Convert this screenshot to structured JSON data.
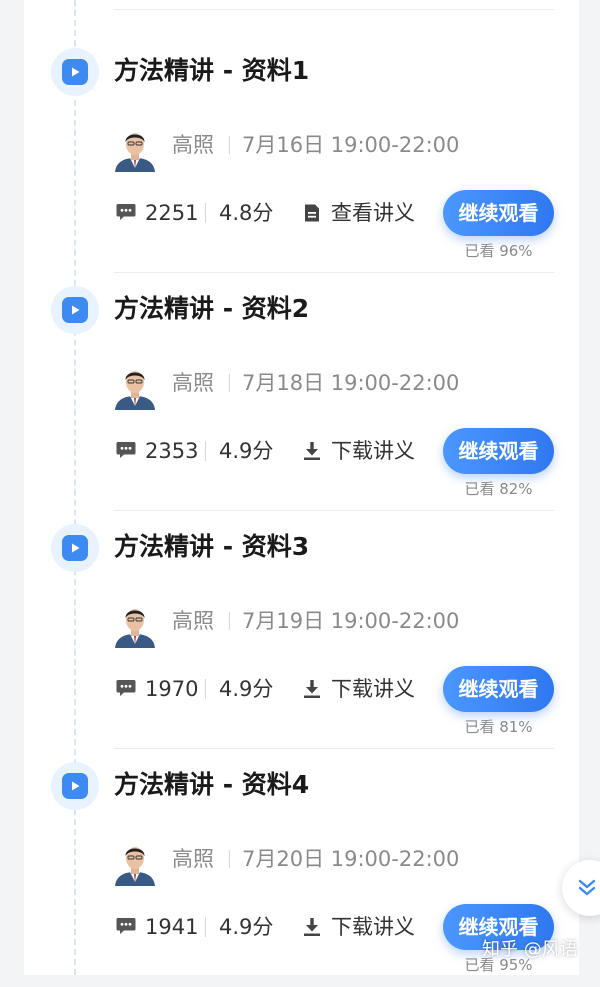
{
  "lessons": [
    {
      "title": "方法精讲 - 资料1",
      "teacher": "高照",
      "time": "7月16日 19:00-22:00",
      "comments": "2251",
      "rating": "4.8分",
      "note_icon": "document-icon",
      "note_label": "查看讲义",
      "button_label": "继续观看",
      "progress": "已看 96%"
    },
    {
      "title": "方法精讲 - 资料2",
      "teacher": "高照",
      "time": "7月18日 19:00-22:00",
      "comments": "2353",
      "rating": "4.9分",
      "note_icon": "download-icon",
      "note_label": "下载讲义",
      "button_label": "继续观看",
      "progress": "已看 82%"
    },
    {
      "title": "方法精讲 - 资料3",
      "teacher": "高照",
      "time": "7月19日 19:00-22:00",
      "comments": "1970",
      "rating": "4.9分",
      "note_icon": "download-icon",
      "note_label": "下载讲义",
      "button_label": "继续观看",
      "progress": "已看 81%"
    },
    {
      "title": "方法精讲 - 资料4",
      "teacher": "高照",
      "time": "7月20日 19:00-22:00",
      "comments": "1941",
      "rating": "4.9分",
      "note_icon": "download-icon",
      "note_label": "下载讲义",
      "button_label": "继续观看",
      "progress": "已看 95%"
    }
  ],
  "watermark": "知乎 @风语",
  "colors": {
    "accent": "#3d8bf2",
    "node_bg": "#e9f2ff",
    "text_muted": "#8a8a8a"
  }
}
